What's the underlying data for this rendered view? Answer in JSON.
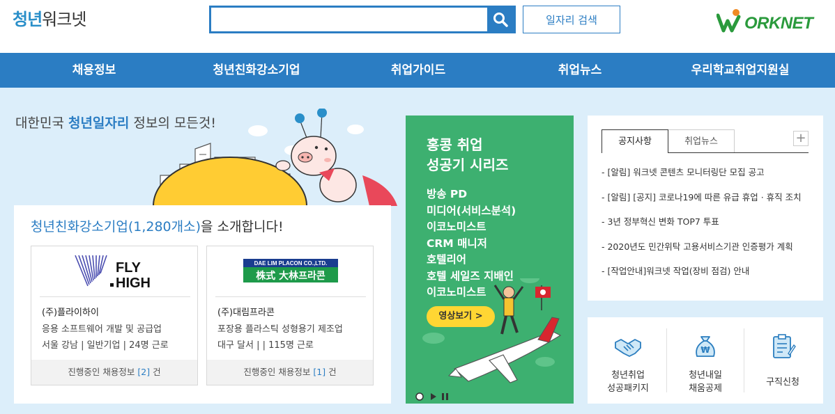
{
  "header": {
    "logo": {
      "part1": "청년",
      "part2": "워크넷"
    },
    "search": {
      "value": "",
      "placeholder": ""
    },
    "job_search_label": "일자리 검색",
    "brand_logo": "WORKNET"
  },
  "nav": [
    {
      "label": "채용정보"
    },
    {
      "label": "청년친화강소기업"
    },
    {
      "label": "취업가이드"
    },
    {
      "label": "취업뉴스"
    },
    {
      "label": "우리학교취업지원실"
    }
  ],
  "tagline": {
    "pre": "대한민국 ",
    "highlight": "청년일자리",
    "post": " 정보의 모든것!"
  },
  "intro": {
    "title_hl": "청년친화강소기업(1,280개소)",
    "title_rest": "을 소개합니다!",
    "companies": [
      {
        "logo_text": [
          "FLY",
          "HIGH"
        ],
        "name": "(주)플라이하이",
        "desc": "응용 소프트웨어 개발 및 공급업",
        "loc": "서울 강남 | 일반기업 | 24명 근로",
        "foot_pre": "진행중인 채용정보 ",
        "foot_count": "[2]",
        "foot_post": " 건"
      },
      {
        "logo_text": [
          "DAE LIM PLACON CO.,LTD.",
          "株式 大林프라콘"
        ],
        "name": "(주)대림프라콘",
        "desc": "포장용 플라스틱 성형용기 제조업",
        "loc": "대구 달서 | | 115명 근로",
        "foot_pre": "진행중인 채용정보 ",
        "foot_count": "[1]",
        "foot_post": " 건"
      }
    ]
  },
  "banner": {
    "title": [
      "홍콩 취업",
      "성공기 시리즈"
    ],
    "items": [
      "방송 PD",
      "미디어(서비스분석)",
      "이코노미스트",
      "CRM 매니저",
      "호텔리어",
      "호텔 세일즈 지배인",
      "이코노미스트"
    ],
    "button": "영상보기 >",
    "accent": "#3db070",
    "button_color": "#ffd633"
  },
  "notice": {
    "tabs": [
      "공지사항",
      "취업뉴스"
    ],
    "items": [
      "- [알림] 워크넷 콘텐츠 모니터링단 모집 공고",
      "- [알림] [공지] 코로나19에 따른 유급 휴업 · 휴직 조치",
      "- 3년 정부혁신 변화 TOP7 투표",
      "- 2020년도 민간위탁 고용서비스기관 인증평가 계획",
      "- [작업안내]워크넷 작업(장비 점검) 안내"
    ]
  },
  "quick": [
    {
      "lines": [
        "청년취업",
        "성공패키지"
      ],
      "icon": "handshake-icon"
    },
    {
      "lines": [
        "청년내일",
        "채움공제"
      ],
      "icon": "money-bag-icon"
    },
    {
      "lines": [
        "구직신청"
      ],
      "icon": "form-icon"
    }
  ],
  "colors": {
    "primary": "#2b7dc3",
    "background": "#dceefa",
    "worknet_green": "#2a9a3c"
  }
}
